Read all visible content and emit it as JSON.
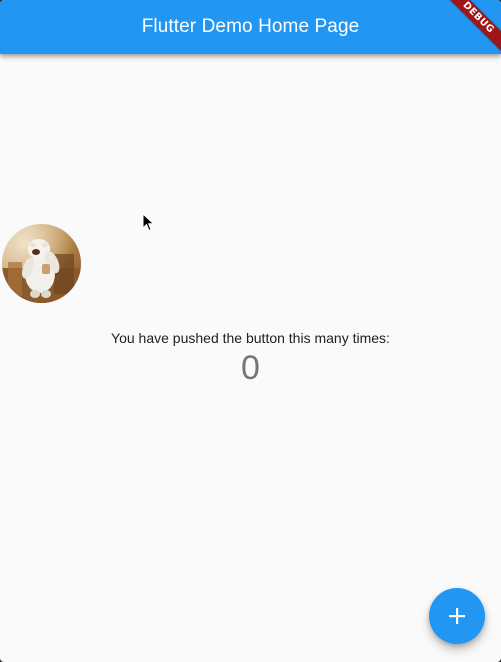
{
  "appbar": {
    "title": "Flutter Demo Home Page",
    "color": "#2196f3"
  },
  "debug_banner": {
    "label": "DEBUG",
    "color": "#a01616"
  },
  "avatar": {
    "icon": "avatar-image"
  },
  "body": {
    "message": "You have pushed the button this many times:",
    "counter": "0",
    "background": "#fafafa"
  },
  "fab": {
    "icon": "plus-icon",
    "color": "#2196f3"
  },
  "pointer": {
    "icon": "mouse-pointer-icon"
  }
}
